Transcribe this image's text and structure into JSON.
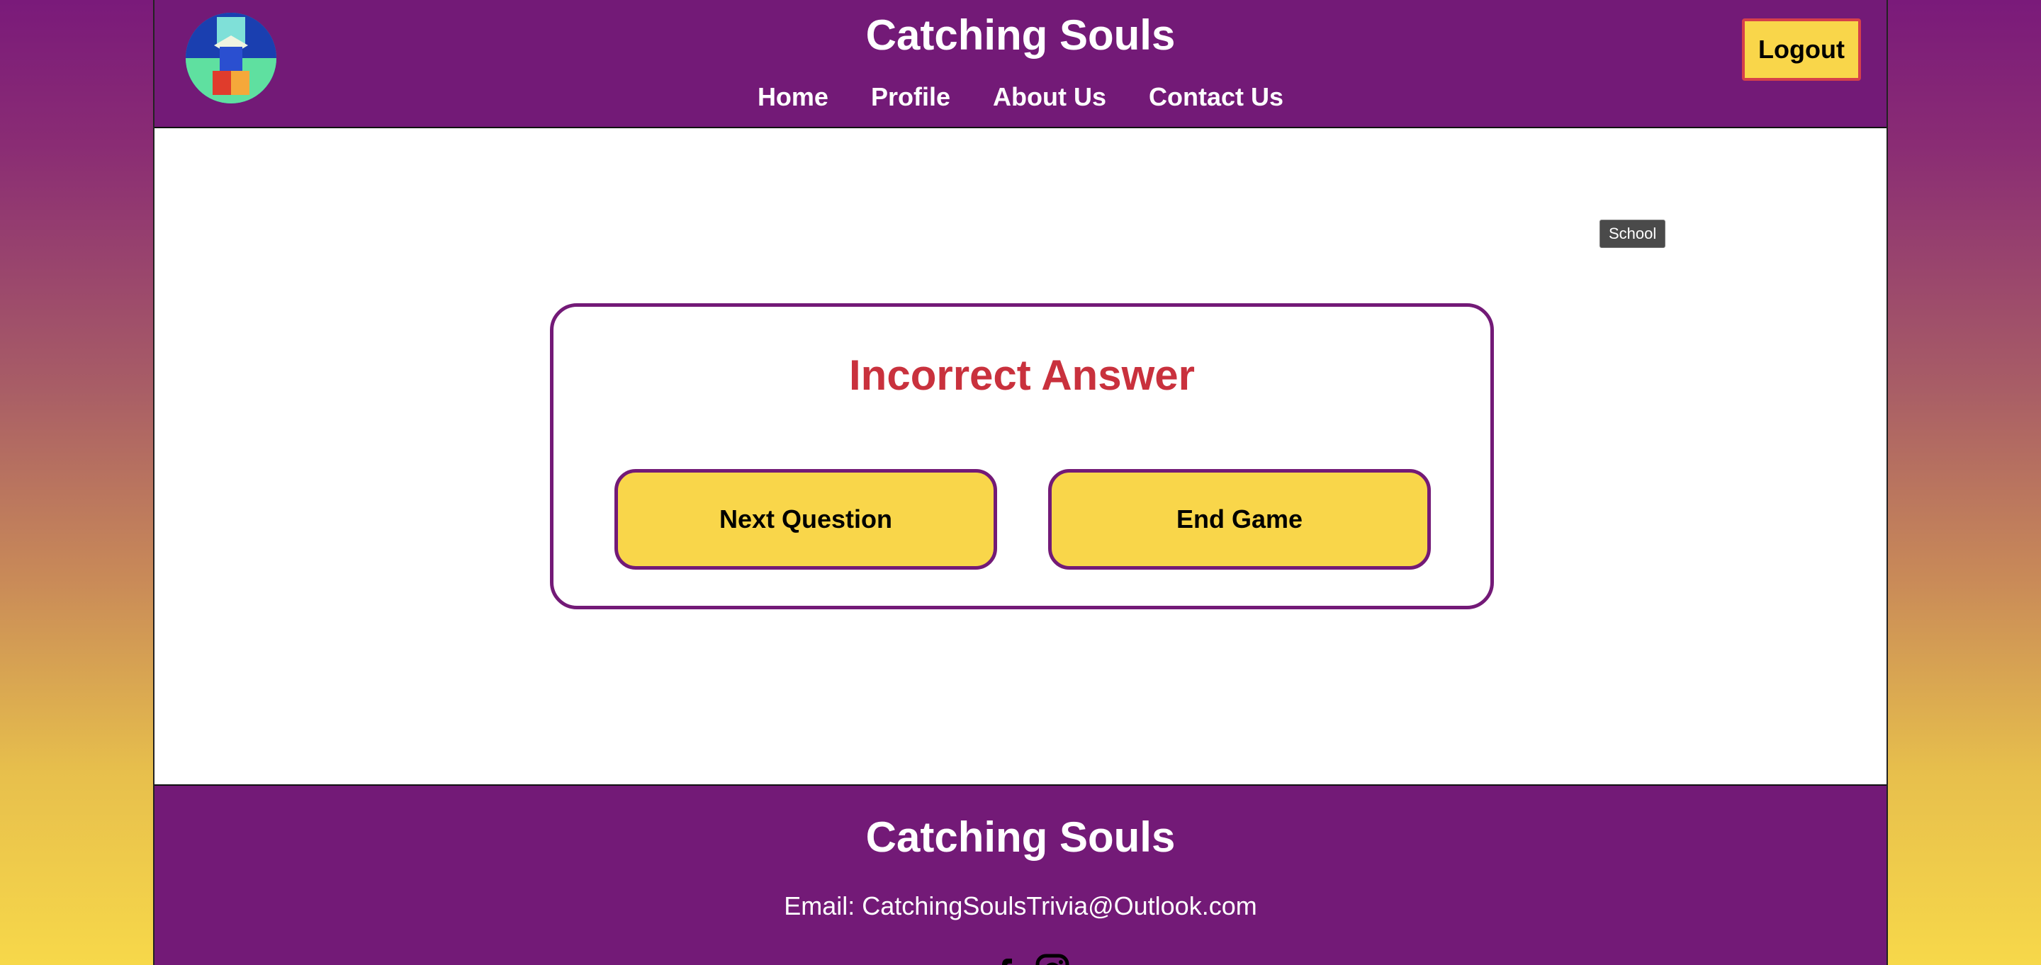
{
  "header": {
    "site_title": "Catching Souls",
    "logout_label": "Logout",
    "nav": [
      {
        "label": "Home"
      },
      {
        "label": "Profile"
      },
      {
        "label": "About Us"
      },
      {
        "label": "Contact Us"
      }
    ],
    "logo_icon": "school-book-logo-icon"
  },
  "tooltip": {
    "text": "School"
  },
  "result": {
    "title": "Incorrect Answer",
    "title_color": "#c9313d",
    "next_label": "Next Question",
    "end_label": "End Game"
  },
  "footer": {
    "title": "Catching Souls",
    "email": "Email: CatchingSoulsTrivia@Outlook.com",
    "social_icons": [
      "facebook-icon",
      "instagram-icon"
    ]
  },
  "colors": {
    "brand_purple": "#731a77",
    "accent_yellow": "#f9d64a",
    "logout_border": "#d6404a"
  }
}
